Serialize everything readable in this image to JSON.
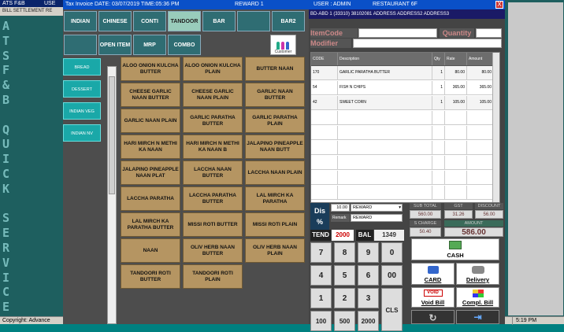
{
  "outer": {
    "title_left": "ATS F&B",
    "title_mid": "USE",
    "menu": "BILL  SETTLEMENT  RE",
    "side_letters": [
      "A",
      "T",
      "S",
      "F",
      "&",
      "B",
      "",
      "Q",
      "U",
      "I",
      "C",
      "K",
      "",
      "S",
      "E",
      "R",
      "V",
      "I",
      "C",
      "E"
    ],
    "status_left": "Copyright: Advance",
    "status_clock": "5:19 PM"
  },
  "window": {
    "title": "Tax Invoice  DATE: 03/07/2019   TIME:05:36 PM",
    "reward": "REWARD 1",
    "user": "USER : ADMIN",
    "restaurant": "RESTAURANT 6F",
    "close": "X"
  },
  "categories": {
    "row1": [
      "INDIAN",
      "CHINESE",
      "CONTI",
      "TANDOOR",
      "BAR",
      "",
      "BAR2"
    ],
    "row2": [
      "",
      "OPEN ITEM",
      "MRP",
      "COMBO"
    ],
    "active": "TANDOOR"
  },
  "customer_logo": "Customer",
  "subcategories": [
    "BREAD",
    "DESSERT",
    "INDIAN VEG",
    "INDIAN NV"
  ],
  "items": [
    [
      "ALOO ONION KULCHA BUTTER",
      "ALOO ONION KULCHA PLAIN",
      "BUTTER NAAN"
    ],
    [
      "CHEESE GARLIC NAAN BUTTER",
      "CHEESE GARLIC NAAN PLAIN",
      "GARLIC NAAN BUTTER"
    ],
    [
      "GARLIC NAAN PLAIN",
      "GARLIC PARATHA BUTTER",
      "GARLIC PARATHA PLAIN"
    ],
    [
      "HARI MIRCH N METHI KA NAAN",
      "HARI MIRCH N METHI KA NAAN B",
      "JALAPINO PINEAPPLE NAAN BUTT"
    ],
    [
      "JALAPINO PINEAPPLE NAAN PLAT",
      "LACCHA NAAN BUTTER",
      "LACCHA NAAN PLAIN"
    ],
    [
      "LACCHA PARATHA",
      "LACCHA PARATHA BUTTER",
      "LAL MIRCH KA PARATHA"
    ],
    [
      "LAL MIRCH KA PARATHA BUTTER",
      "MISSI ROTI BUTTER",
      "MISSI ROTI PLAIN"
    ],
    [
      "NAAN",
      "OLIV HERB NAAN BUTTER",
      "OLIV HERB NAAN PLAIN"
    ],
    [
      "TANDOORI ROTI BUTTER",
      "TANDOORI ROTI PLAIN"
    ]
  ],
  "bill": {
    "info": "BD-ABD 1 (33310) 38102081 ADDRESS ADDRESS2    ADDRESS3",
    "item_code_label": "ItemCode",
    "quantity_label": "Quantity",
    "modifier_label": "Modifier",
    "columns": [
      "CODE",
      "Description",
      "Qty",
      "Rate",
      "Amount"
    ],
    "rows": [
      [
        "170",
        "GARLIC PARATHA BUTTER",
        "1",
        "80.00",
        "80.00"
      ],
      [
        "54",
        "FISH N CHIPS",
        "1",
        "365.00",
        "365.00"
      ],
      [
        "42",
        "SWEET CORN",
        "1",
        "105.00",
        "105.00"
      ]
    ],
    "discount_label": "Dis %",
    "discount_value": "10.00",
    "discount_type": "REWARD",
    "remark_label": "Remark",
    "remark_value": "REWARD",
    "sub_total_label": "SUB TOTAL",
    "gst_label": "GST",
    "discount_hdr": "DISCOUNT",
    "sub_total": "560.00",
    "gst": "31.26",
    "discount": "56.00",
    "service_charge_label": "S CHARGE",
    "amount_label": "AMOUNT",
    "service_charge": "50.40",
    "amount": "586.00"
  },
  "tender": {
    "tend_label": "TEND",
    "tend_value": "2000",
    "bal_label": "BAL",
    "bal_value": "1349",
    "keys": [
      "7",
      "8",
      "9",
      "0",
      "4",
      "5",
      "6",
      "00",
      "1",
      "2",
      "3",
      "CLS",
      "100",
      "500",
      "2000"
    ]
  },
  "actions": {
    "cash": "CASH",
    "card": "CARD",
    "delivery": "Delivery",
    "void_bill": "Void Bill",
    "compl_bill": "Compl. Bill",
    "void_badge": "VOID"
  },
  "colors": {
    "item_bg": "#b59562",
    "category_bg": "#2f6d73",
    "subcategory_bg": "#1aa8a8",
    "title_bar": "#0a50c8"
  }
}
